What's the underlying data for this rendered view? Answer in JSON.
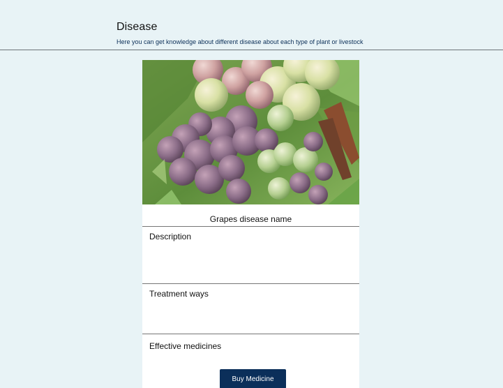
{
  "header": {
    "title": "Disease",
    "subtitle": "Here you can get knowledge about different disease about each type of plant or livestock"
  },
  "card": {
    "disease_name": "Grapes disease name",
    "sections": {
      "description_label": "Description",
      "treatment_label": "Treatment ways",
      "medicines_label": "Effective medicines"
    },
    "buy_button_label": "Buy Medicine"
  },
  "colors": {
    "page_background": "#e8f3f6",
    "accent": "#0b2f5a"
  }
}
